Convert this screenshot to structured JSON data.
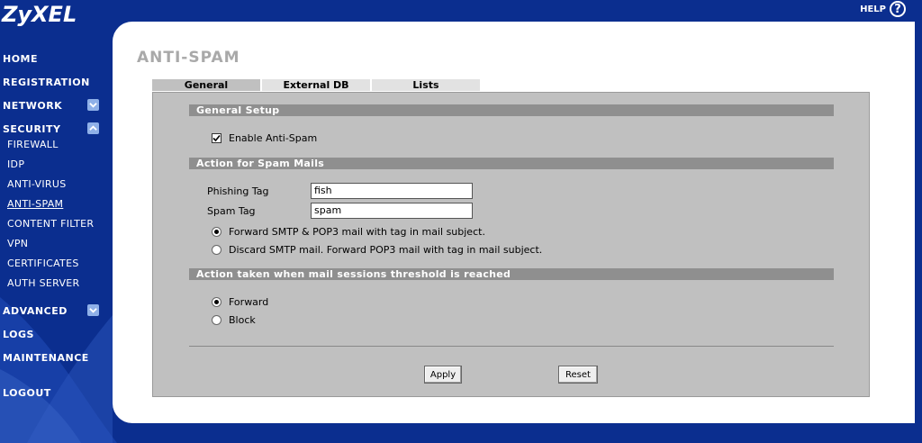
{
  "brand": {
    "logo": "ZyXEL",
    "help_label": "HELP",
    "help_icon": "?"
  },
  "sidebar": {
    "items": [
      {
        "label": "HOME"
      },
      {
        "label": "REGISTRATION"
      },
      {
        "label": "NETWORK",
        "toggle": "expand"
      },
      {
        "label": "SECURITY",
        "toggle": "collapse"
      },
      {
        "label": "ADVANCED",
        "toggle": "expand"
      },
      {
        "label": "LOGS"
      },
      {
        "label": "MAINTENANCE"
      },
      {
        "label": "LOGOUT"
      }
    ],
    "security_sub": [
      {
        "label": "FIREWALL"
      },
      {
        "label": "IDP"
      },
      {
        "label": "ANTI-VIRUS"
      },
      {
        "label": "ANTI-SPAM",
        "active": true
      },
      {
        "label": "CONTENT FILTER"
      },
      {
        "label": "VPN"
      },
      {
        "label": "CERTIFICATES"
      },
      {
        "label": "AUTH SERVER"
      }
    ]
  },
  "page": {
    "title": "ANTI-SPAM",
    "tabs": [
      {
        "label": "General",
        "active": true
      },
      {
        "label": "External DB"
      },
      {
        "label": "Lists"
      }
    ]
  },
  "general_setup": {
    "header": "General Setup",
    "enable_label": "Enable Anti-Spam",
    "enable_checked": true
  },
  "spam_action": {
    "header": "Action for Spam Mails",
    "phishing_label": "Phishing Tag",
    "phishing_value": "fish",
    "spam_label": "Spam Tag",
    "spam_value": "spam",
    "option_forward": "Forward SMTP & POP3 mail with tag in mail subject.",
    "option_discard": "Discard SMTP mail. Forward POP3 mail with tag in mail subject.",
    "selected": "forward"
  },
  "threshold_action": {
    "header": "Action taken when mail sessions threshold is reached",
    "option_forward": "Forward",
    "option_block": "Block",
    "selected": "forward"
  },
  "buttons": {
    "apply": "Apply",
    "reset": "Reset"
  },
  "colors": {
    "sidebar_bg": "#0b2e8f",
    "section_bar": "#8f8f8f",
    "content_bg": "#c0c0c0",
    "title": "#a9a9a9"
  }
}
